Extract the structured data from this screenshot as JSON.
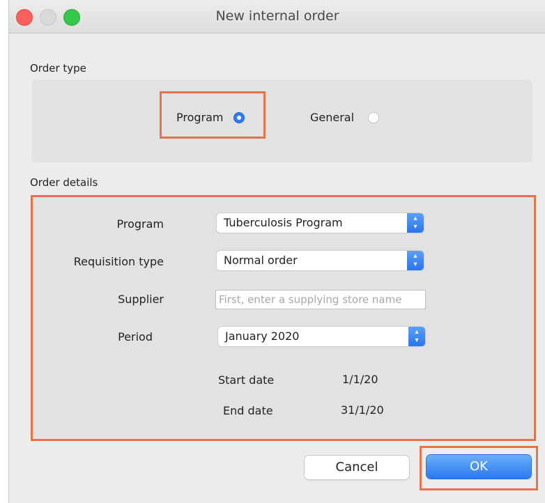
{
  "window": {
    "title": "New internal order"
  },
  "order_type": {
    "label": "Order type",
    "options": [
      {
        "label": "Program",
        "selected": true
      },
      {
        "label": "General",
        "selected": false
      }
    ]
  },
  "order_details": {
    "label": "Order details",
    "program": {
      "label": "Program",
      "value": "Tuberculosis Program"
    },
    "requisition_type": {
      "label": "Requisition type",
      "value": "Normal order"
    },
    "supplier": {
      "label": "Supplier",
      "value": "",
      "placeholder": "First, enter a supplying store name"
    },
    "period": {
      "label": "Period",
      "value": "January 2020"
    },
    "start_date": {
      "label": "Start date",
      "value": "1/1/20"
    },
    "end_date": {
      "label": "End date",
      "value": "31/1/20"
    }
  },
  "buttons": {
    "cancel": "Cancel",
    "ok": "OK"
  },
  "colors": {
    "highlight": "#e8714a",
    "accent": "#2e7cf6",
    "window_bg": "#ececec",
    "panel_bg": "#e2e2e2"
  },
  "icons": {
    "close": "close-icon",
    "minimize": "minimize-icon",
    "zoom": "zoom-icon",
    "stepper": "chevron-updown-icon"
  }
}
